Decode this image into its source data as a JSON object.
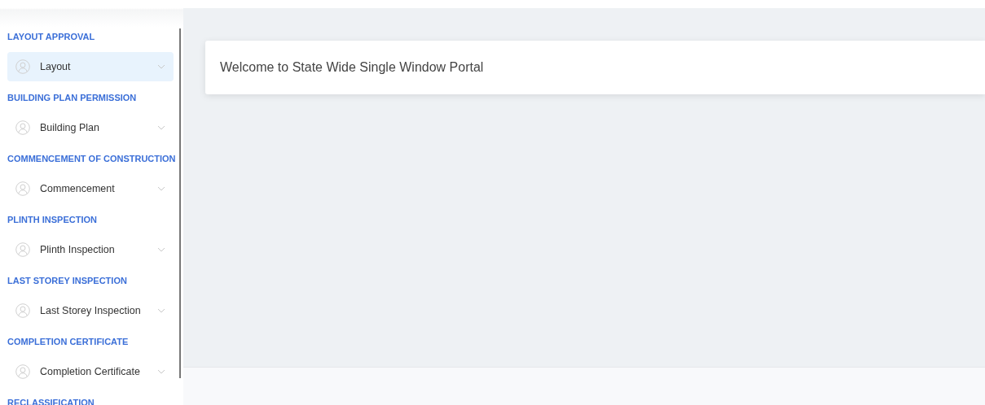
{
  "sidebar": {
    "sections": [
      {
        "title": "LAYOUT APPROVAL",
        "items": [
          {
            "label": "Layout",
            "selected": true
          }
        ]
      },
      {
        "title": "BUILDING PLAN PERMISSION",
        "items": [
          {
            "label": "Building Plan",
            "selected": false
          }
        ]
      },
      {
        "title": "COMMENCEMENT OF CONSTRUCTION",
        "items": [
          {
            "label": "Commencement",
            "selected": false
          }
        ]
      },
      {
        "title": "PLINTH INSPECTION",
        "items": [
          {
            "label": "Plinth Inspection",
            "selected": false
          }
        ]
      },
      {
        "title": "LAST STOREY INSPECTION",
        "items": [
          {
            "label": "Last Storey Inspection",
            "selected": false
          }
        ]
      },
      {
        "title": "COMPLETION CERTIFICATE",
        "items": [
          {
            "label": "Completion Certificate",
            "selected": false
          }
        ]
      },
      {
        "title": "RECLASSIFICATION"
      }
    ]
  },
  "main": {
    "welcome": "Welcome to State Wide Single Window Portal"
  }
}
